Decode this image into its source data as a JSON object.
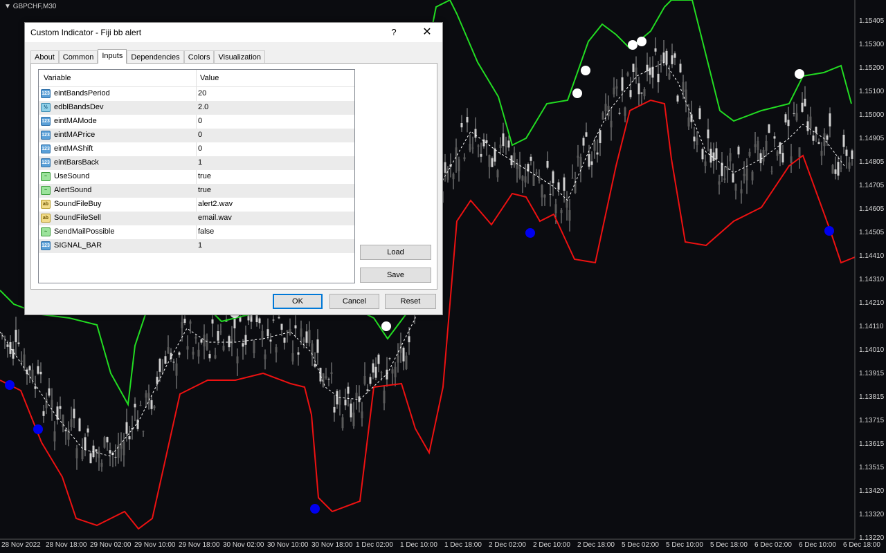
{
  "chart": {
    "symbol": "GBPCHF,M30",
    "price_ticks": [
      "1.15405",
      "1.15300",
      "1.15200",
      "1.15100",
      "1.15000",
      "1.14905",
      "1.14805",
      "1.14705",
      "1.14605",
      "1.14505",
      "1.14410",
      "1.14310",
      "1.14210",
      "1.14110",
      "1.14010",
      "1.13915",
      "1.13815",
      "1.13715",
      "1.13615",
      "1.13515",
      "1.13420",
      "1.13320",
      "1.13220"
    ],
    "time_ticks": [
      "28 Nov 2022",
      "28 Nov 18:00",
      "29 Nov 02:00",
      "29 Nov 10:00",
      "29 Nov 18:00",
      "30 Nov 02:00",
      "30 Nov 10:00",
      "30 Nov 18:00",
      "1 Dec 02:00",
      "1 Dec 10:00",
      "1 Dec 18:00",
      "2 Dec 02:00",
      "2 Dec 10:00",
      "2 Dec 18:00",
      "5 Dec 02:00",
      "5 Dec 10:00",
      "5 Dec 18:00",
      "6 Dec 02:00",
      "6 Dec 10:00",
      "6 Dec 18:00"
    ],
    "colors": {
      "upper_band": "#22dd22",
      "lower_band": "#ee1111",
      "middle_band": "#ffffff",
      "sell_signal": "#ffffff",
      "buy_signal": "#0000ee",
      "candles": "#9a9a9a"
    }
  },
  "dialog": {
    "title": "Custom Indicator - Fiji bb alert",
    "help_icon": "?",
    "close_icon": "✕",
    "tabs": [
      "About",
      "Common",
      "Inputs",
      "Dependencies",
      "Colors",
      "Visualization"
    ],
    "active_tab": "Inputs",
    "columns": {
      "variable": "Variable",
      "value": "Value"
    },
    "rows": [
      {
        "icon": "int",
        "icon_text": "123",
        "name": "eintBandsPeriod",
        "value": "20"
      },
      {
        "icon": "dbl",
        "icon_text": "½",
        "name": "edblBandsDev",
        "value": "2.0"
      },
      {
        "icon": "int",
        "icon_text": "123",
        "name": "eintMAMode",
        "value": "0"
      },
      {
        "icon": "int",
        "icon_text": "123",
        "name": "eintMAPrice",
        "value": "0"
      },
      {
        "icon": "int",
        "icon_text": "123",
        "name": "eintMAShift",
        "value": "0"
      },
      {
        "icon": "int",
        "icon_text": "123",
        "name": "eintBarsBack",
        "value": "1"
      },
      {
        "icon": "bool",
        "icon_text": "~",
        "name": "UseSound",
        "value": "true"
      },
      {
        "icon": "bool",
        "icon_text": "~",
        "name": "AlertSound",
        "value": "true"
      },
      {
        "icon": "str",
        "icon_text": "ab",
        "name": "SoundFileBuy",
        "value": "alert2.wav"
      },
      {
        "icon": "str",
        "icon_text": "ab",
        "name": "SoundFileSell",
        "value": "email.wav"
      },
      {
        "icon": "bool",
        "icon_text": "~",
        "name": "SendMailPossible",
        "value": "false"
      },
      {
        "icon": "int",
        "icon_text": "123",
        "name": "SIGNAL_BAR",
        "value": "1"
      }
    ],
    "buttons": {
      "load": "Load",
      "save": "Save",
      "ok": "OK",
      "cancel": "Cancel",
      "reset": "Reset"
    }
  }
}
